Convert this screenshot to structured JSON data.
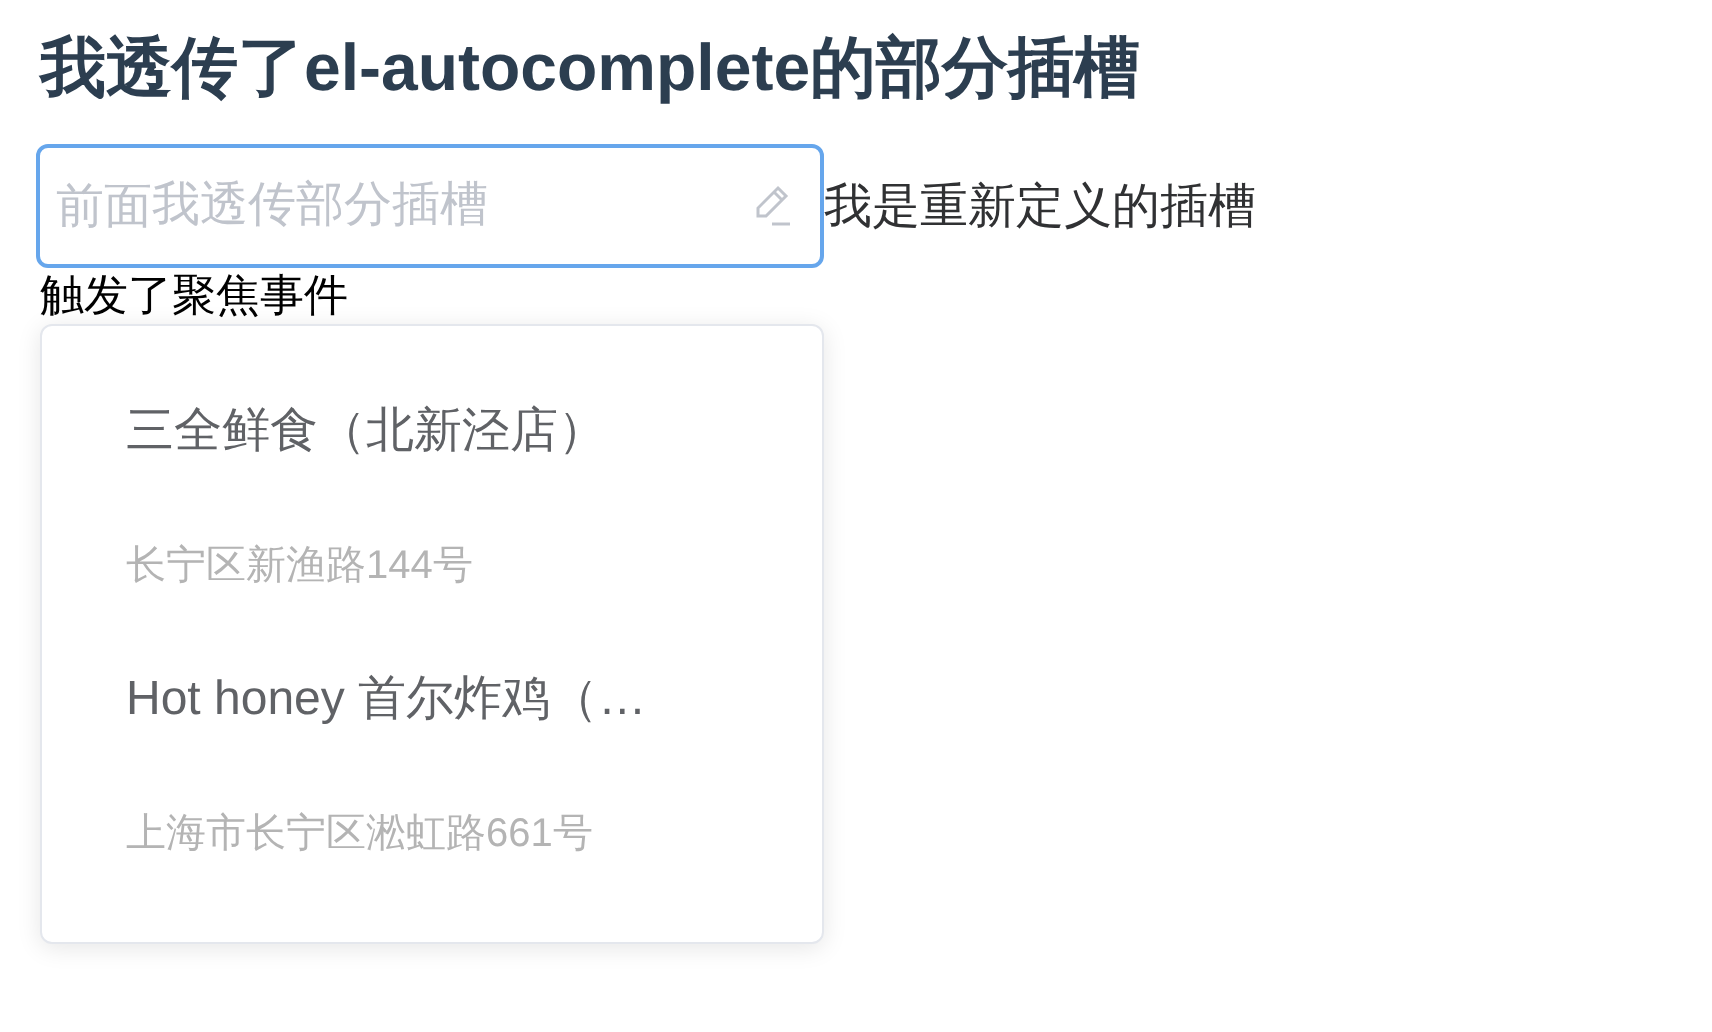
{
  "title": "我透传了el-autocomplete的部分插槽",
  "input": {
    "prefix": "前面",
    "placeholder": "我透传部分插槽",
    "focused": true
  },
  "append": "我是重新定义的插槽",
  "status": "触发了聚焦事件",
  "suggestions": [
    {
      "name": "三全鲜食（北新泾店）",
      "address": "长宁区新渔路144号"
    },
    {
      "name": "Hot honey 首尔炸鸡（…",
      "address": "上海市长宁区淞虹路661号"
    }
  ]
}
